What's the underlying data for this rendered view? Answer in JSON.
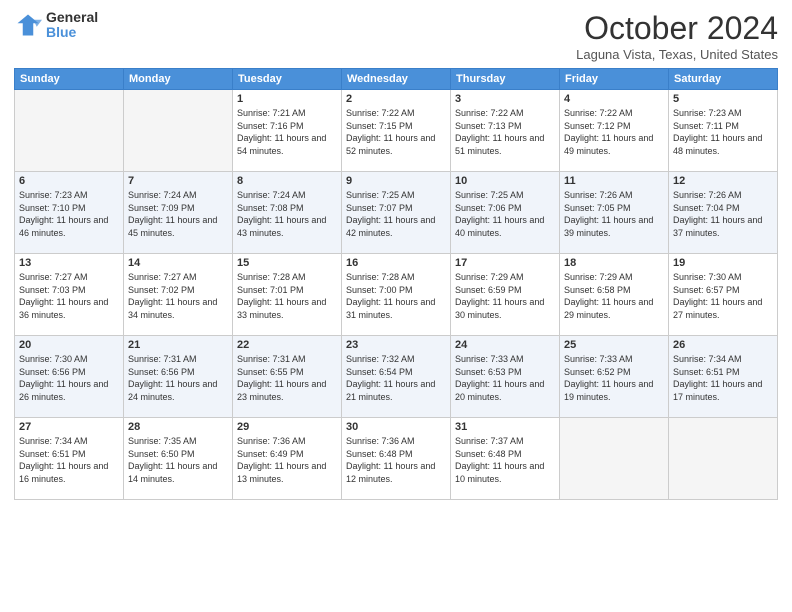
{
  "header": {
    "logo_general": "General",
    "logo_blue": "Blue",
    "month_title": "October 2024",
    "location": "Laguna Vista, Texas, United States"
  },
  "weekdays": [
    "Sunday",
    "Monday",
    "Tuesday",
    "Wednesday",
    "Thursday",
    "Friday",
    "Saturday"
  ],
  "weeks": [
    [
      {
        "day": "",
        "sunrise": "",
        "sunset": "",
        "daylight": ""
      },
      {
        "day": "",
        "sunrise": "",
        "sunset": "",
        "daylight": ""
      },
      {
        "day": "1",
        "sunrise": "Sunrise: 7:21 AM",
        "sunset": "Sunset: 7:16 PM",
        "daylight": "Daylight: 11 hours and 54 minutes."
      },
      {
        "day": "2",
        "sunrise": "Sunrise: 7:22 AM",
        "sunset": "Sunset: 7:15 PM",
        "daylight": "Daylight: 11 hours and 52 minutes."
      },
      {
        "day": "3",
        "sunrise": "Sunrise: 7:22 AM",
        "sunset": "Sunset: 7:13 PM",
        "daylight": "Daylight: 11 hours and 51 minutes."
      },
      {
        "day": "4",
        "sunrise": "Sunrise: 7:22 AM",
        "sunset": "Sunset: 7:12 PM",
        "daylight": "Daylight: 11 hours and 49 minutes."
      },
      {
        "day": "5",
        "sunrise": "Sunrise: 7:23 AM",
        "sunset": "Sunset: 7:11 PM",
        "daylight": "Daylight: 11 hours and 48 minutes."
      }
    ],
    [
      {
        "day": "6",
        "sunrise": "Sunrise: 7:23 AM",
        "sunset": "Sunset: 7:10 PM",
        "daylight": "Daylight: 11 hours and 46 minutes."
      },
      {
        "day": "7",
        "sunrise": "Sunrise: 7:24 AM",
        "sunset": "Sunset: 7:09 PM",
        "daylight": "Daylight: 11 hours and 45 minutes."
      },
      {
        "day": "8",
        "sunrise": "Sunrise: 7:24 AM",
        "sunset": "Sunset: 7:08 PM",
        "daylight": "Daylight: 11 hours and 43 minutes."
      },
      {
        "day": "9",
        "sunrise": "Sunrise: 7:25 AM",
        "sunset": "Sunset: 7:07 PM",
        "daylight": "Daylight: 11 hours and 42 minutes."
      },
      {
        "day": "10",
        "sunrise": "Sunrise: 7:25 AM",
        "sunset": "Sunset: 7:06 PM",
        "daylight": "Daylight: 11 hours and 40 minutes."
      },
      {
        "day": "11",
        "sunrise": "Sunrise: 7:26 AM",
        "sunset": "Sunset: 7:05 PM",
        "daylight": "Daylight: 11 hours and 39 minutes."
      },
      {
        "day": "12",
        "sunrise": "Sunrise: 7:26 AM",
        "sunset": "Sunset: 7:04 PM",
        "daylight": "Daylight: 11 hours and 37 minutes."
      }
    ],
    [
      {
        "day": "13",
        "sunrise": "Sunrise: 7:27 AM",
        "sunset": "Sunset: 7:03 PM",
        "daylight": "Daylight: 11 hours and 36 minutes."
      },
      {
        "day": "14",
        "sunrise": "Sunrise: 7:27 AM",
        "sunset": "Sunset: 7:02 PM",
        "daylight": "Daylight: 11 hours and 34 minutes."
      },
      {
        "day": "15",
        "sunrise": "Sunrise: 7:28 AM",
        "sunset": "Sunset: 7:01 PM",
        "daylight": "Daylight: 11 hours and 33 minutes."
      },
      {
        "day": "16",
        "sunrise": "Sunrise: 7:28 AM",
        "sunset": "Sunset: 7:00 PM",
        "daylight": "Daylight: 11 hours and 31 minutes."
      },
      {
        "day": "17",
        "sunrise": "Sunrise: 7:29 AM",
        "sunset": "Sunset: 6:59 PM",
        "daylight": "Daylight: 11 hours and 30 minutes."
      },
      {
        "day": "18",
        "sunrise": "Sunrise: 7:29 AM",
        "sunset": "Sunset: 6:58 PM",
        "daylight": "Daylight: 11 hours and 29 minutes."
      },
      {
        "day": "19",
        "sunrise": "Sunrise: 7:30 AM",
        "sunset": "Sunset: 6:57 PM",
        "daylight": "Daylight: 11 hours and 27 minutes."
      }
    ],
    [
      {
        "day": "20",
        "sunrise": "Sunrise: 7:30 AM",
        "sunset": "Sunset: 6:56 PM",
        "daylight": "Daylight: 11 hours and 26 minutes."
      },
      {
        "day": "21",
        "sunrise": "Sunrise: 7:31 AM",
        "sunset": "Sunset: 6:56 PM",
        "daylight": "Daylight: 11 hours and 24 minutes."
      },
      {
        "day": "22",
        "sunrise": "Sunrise: 7:31 AM",
        "sunset": "Sunset: 6:55 PM",
        "daylight": "Daylight: 11 hours and 23 minutes."
      },
      {
        "day": "23",
        "sunrise": "Sunrise: 7:32 AM",
        "sunset": "Sunset: 6:54 PM",
        "daylight": "Daylight: 11 hours and 21 minutes."
      },
      {
        "day": "24",
        "sunrise": "Sunrise: 7:33 AM",
        "sunset": "Sunset: 6:53 PM",
        "daylight": "Daylight: 11 hours and 20 minutes."
      },
      {
        "day": "25",
        "sunrise": "Sunrise: 7:33 AM",
        "sunset": "Sunset: 6:52 PM",
        "daylight": "Daylight: 11 hours and 19 minutes."
      },
      {
        "day": "26",
        "sunrise": "Sunrise: 7:34 AM",
        "sunset": "Sunset: 6:51 PM",
        "daylight": "Daylight: 11 hours and 17 minutes."
      }
    ],
    [
      {
        "day": "27",
        "sunrise": "Sunrise: 7:34 AM",
        "sunset": "Sunset: 6:51 PM",
        "daylight": "Daylight: 11 hours and 16 minutes."
      },
      {
        "day": "28",
        "sunrise": "Sunrise: 7:35 AM",
        "sunset": "Sunset: 6:50 PM",
        "daylight": "Daylight: 11 hours and 14 minutes."
      },
      {
        "day": "29",
        "sunrise": "Sunrise: 7:36 AM",
        "sunset": "Sunset: 6:49 PM",
        "daylight": "Daylight: 11 hours and 13 minutes."
      },
      {
        "day": "30",
        "sunrise": "Sunrise: 7:36 AM",
        "sunset": "Sunset: 6:48 PM",
        "daylight": "Daylight: 11 hours and 12 minutes."
      },
      {
        "day": "31",
        "sunrise": "Sunrise: 7:37 AM",
        "sunset": "Sunset: 6:48 PM",
        "daylight": "Daylight: 11 hours and 10 minutes."
      },
      {
        "day": "",
        "sunrise": "",
        "sunset": "",
        "daylight": ""
      },
      {
        "day": "",
        "sunrise": "",
        "sunset": "",
        "daylight": ""
      }
    ]
  ]
}
